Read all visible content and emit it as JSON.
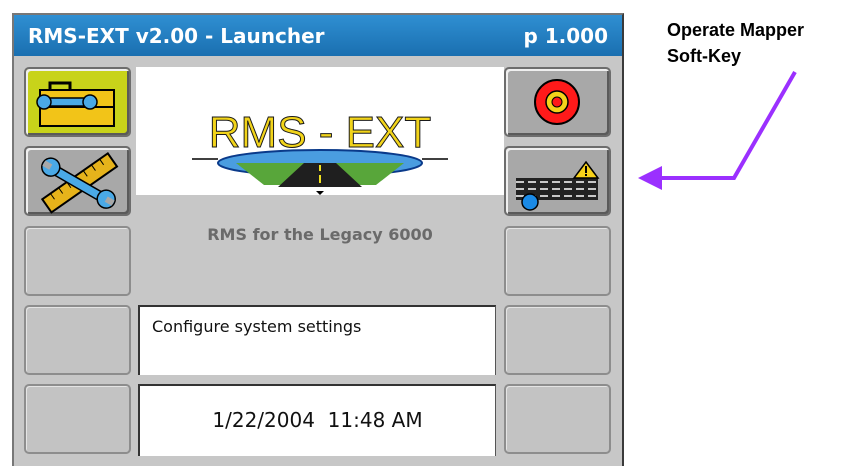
{
  "titlebar": {
    "app_title": "RMS-EXT v2.00 - Launcher",
    "page_indicator": "p 1.000",
    "bg_color": "#2a86c8"
  },
  "logo": {
    "wordmark": "RMS - EXT"
  },
  "subtitle": "RMS for the Legacy 6000",
  "status_message": "Configure system settings",
  "clock": {
    "date": "1/22/2004",
    "time": "11:48 AM"
  },
  "soft_keys": {
    "left": [
      {
        "icon": "toolbox-wrench-icon",
        "selected": true,
        "highlight_color": "#c8d31a"
      },
      {
        "icon": "wrench-ruler-icon",
        "selected": false
      },
      {
        "icon": "",
        "empty": true
      },
      {
        "icon": "",
        "empty": true
      },
      {
        "icon": "",
        "empty": true
      }
    ],
    "right": [
      {
        "icon": "stop-target-icon"
      },
      {
        "icon": "mapper-road-warning-icon"
      },
      {
        "icon": "",
        "empty": true
      },
      {
        "icon": "",
        "empty": true
      },
      {
        "icon": "",
        "empty": true
      }
    ]
  },
  "annotation": {
    "line1": "Operate Mapper",
    "line2": "Soft-Key",
    "arrow_color": "#9b30ff"
  }
}
